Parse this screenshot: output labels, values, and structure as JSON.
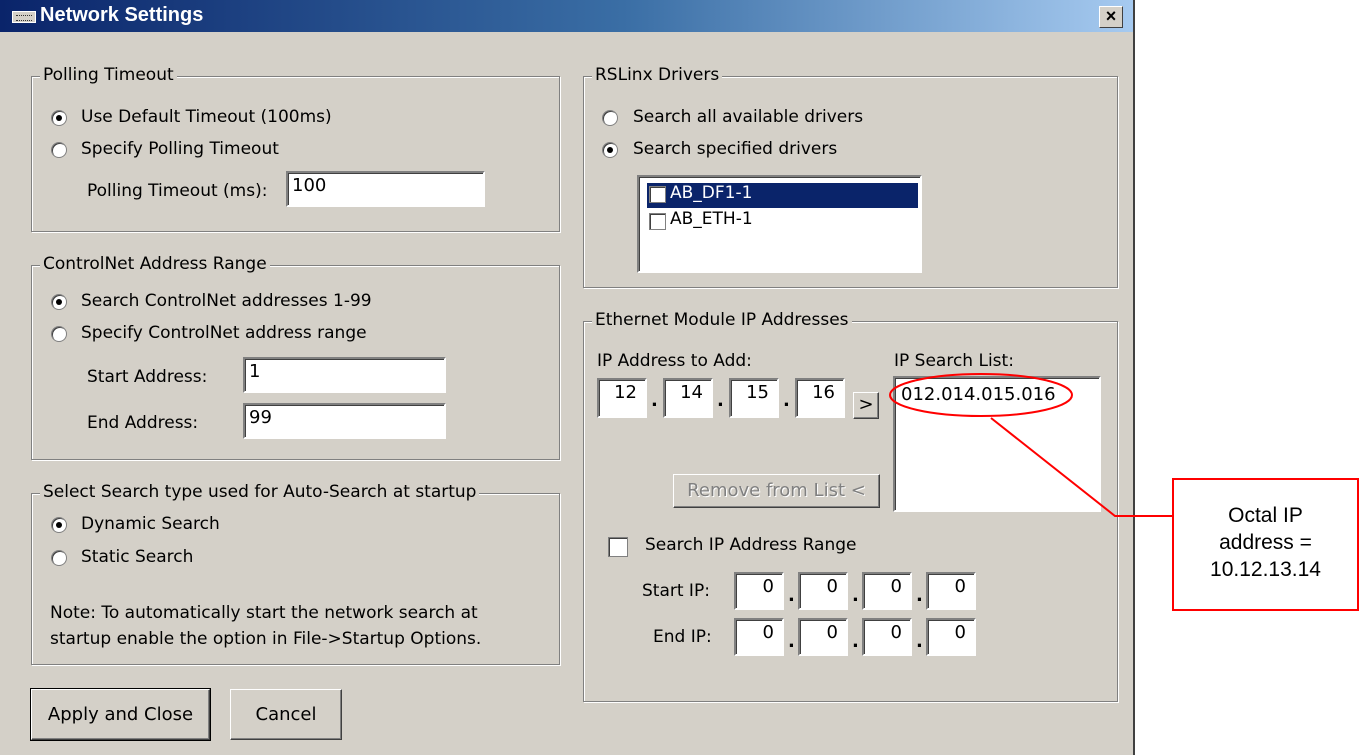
{
  "window": {
    "title": "Network Settings",
    "close_label": "×"
  },
  "polling": {
    "legend": "Polling Timeout",
    "opt_default": "Use Default Timeout (100ms)",
    "opt_specify": "Specify Polling Timeout",
    "timeout_label": "Polling Timeout (ms):",
    "timeout_value": "100"
  },
  "controlnet": {
    "legend": "ControlNet Address Range",
    "opt_all": "Search ControlNet addresses 1-99",
    "opt_specify": "Specify ControlNet address range",
    "start_label": "Start Address:",
    "start_value": "1",
    "end_label": "End Address:",
    "end_value": "99"
  },
  "autosearch": {
    "legend": "Select Search type used for Auto-Search at startup",
    "opt_dynamic": "Dynamic Search",
    "opt_static": "Static Search",
    "note_line1": "Note: To automatically start the network search at",
    "note_line2": "startup enable the option in File->Startup Options."
  },
  "rslinx": {
    "legend": "RSLinx Drivers",
    "opt_all": "Search all available drivers",
    "opt_specified": "Search specified drivers",
    "drivers": [
      "AB_DF1-1",
      "AB_ETH-1"
    ]
  },
  "ethernet": {
    "legend": "Ethernet Module IP Addresses",
    "add_label": "IP Address to Add:",
    "add_octets": [
      "12",
      "14",
      "15",
      "16"
    ],
    "add_button": ">",
    "search_list_label": "IP Search List:",
    "search_list": [
      "012.014.015.016"
    ],
    "remove_button": "Remove from List <",
    "range_label": "Search IP Address Range",
    "start_ip_label": "Start IP:",
    "start_ip": [
      "0",
      "0",
      "0",
      "0"
    ],
    "end_ip_label": "End IP:",
    "end_ip": [
      "0",
      "0",
      "0",
      "0"
    ]
  },
  "buttons": {
    "apply": "Apply and Close",
    "cancel": "Cancel"
  },
  "annotation": {
    "line1": "Octal IP",
    "line2": "address =",
    "line3": "10.12.13.14",
    "color": "#ff0000"
  }
}
